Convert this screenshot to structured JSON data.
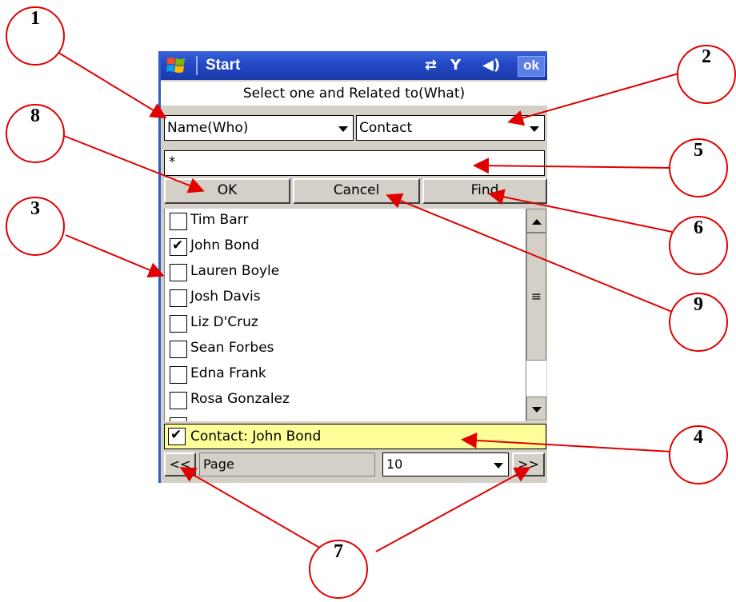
{
  "titlebar": {
    "start_label": "Start",
    "ok_label": "ok"
  },
  "subheader": "Select one and Related to(What)",
  "who_dropdown": "Name(Who)",
  "what_dropdown": "Contact",
  "search_value": "*",
  "buttons": {
    "ok": "OK",
    "cancel": "Cancel",
    "find": "Find"
  },
  "contacts": [
    {
      "name": "Tim Barr",
      "checked": false
    },
    {
      "name": "John Bond",
      "checked": true
    },
    {
      "name": "Lauren Boyle",
      "checked": false
    },
    {
      "name": "Josh Davis",
      "checked": false
    },
    {
      "name": "Liz D'Cruz",
      "checked": false
    },
    {
      "name": "Sean Forbes",
      "checked": false
    },
    {
      "name": "Edna Frank",
      "checked": false
    },
    {
      "name": "Rosa Gonzalez",
      "checked": false
    }
  ],
  "selection_status": "Contact: John Bond",
  "pager": {
    "prev": "<<",
    "page_label": "Page",
    "page_size": "10",
    "next": ">>"
  },
  "callouts": [
    "1",
    "2",
    "3",
    "4",
    "5",
    "6",
    "7",
    "8",
    "9"
  ],
  "colors": {
    "annotation": "#e00000",
    "titlebar": "#2447c7",
    "selection_bg": "#ffff99"
  }
}
